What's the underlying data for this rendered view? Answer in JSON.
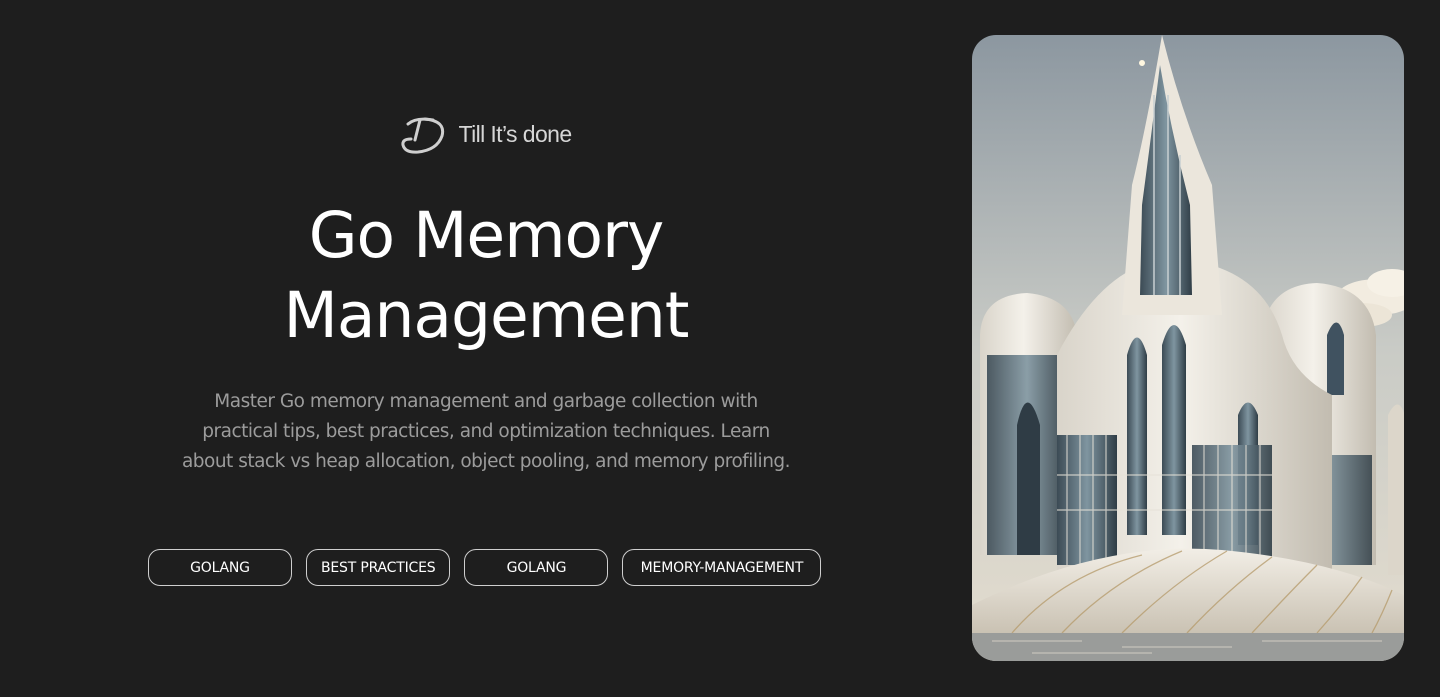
{
  "brand": {
    "name": "Till It’s done",
    "logo_icon": "td-monogram-icon"
  },
  "hero": {
    "title_line1": "Go Memory",
    "title_line2": "Management",
    "description_lines": [
      "Master Go memory management and garbage collection with",
      "practical tips, best practices, and optimization techniques. Learn",
      "about stack vs heap allocation, object pooling, and memory profiling."
    ]
  },
  "tags": [
    {
      "label": "GOLANG"
    },
    {
      "label": "BEST PRACTICES"
    },
    {
      "label": "GOLANG"
    },
    {
      "label": "MEMORY-MANAGEMENT"
    }
  ],
  "colors": {
    "background": "#1e1e1e",
    "title": "#ffffff",
    "description": "#9c9c9c",
    "tag_border": "#cfcfcf"
  }
}
